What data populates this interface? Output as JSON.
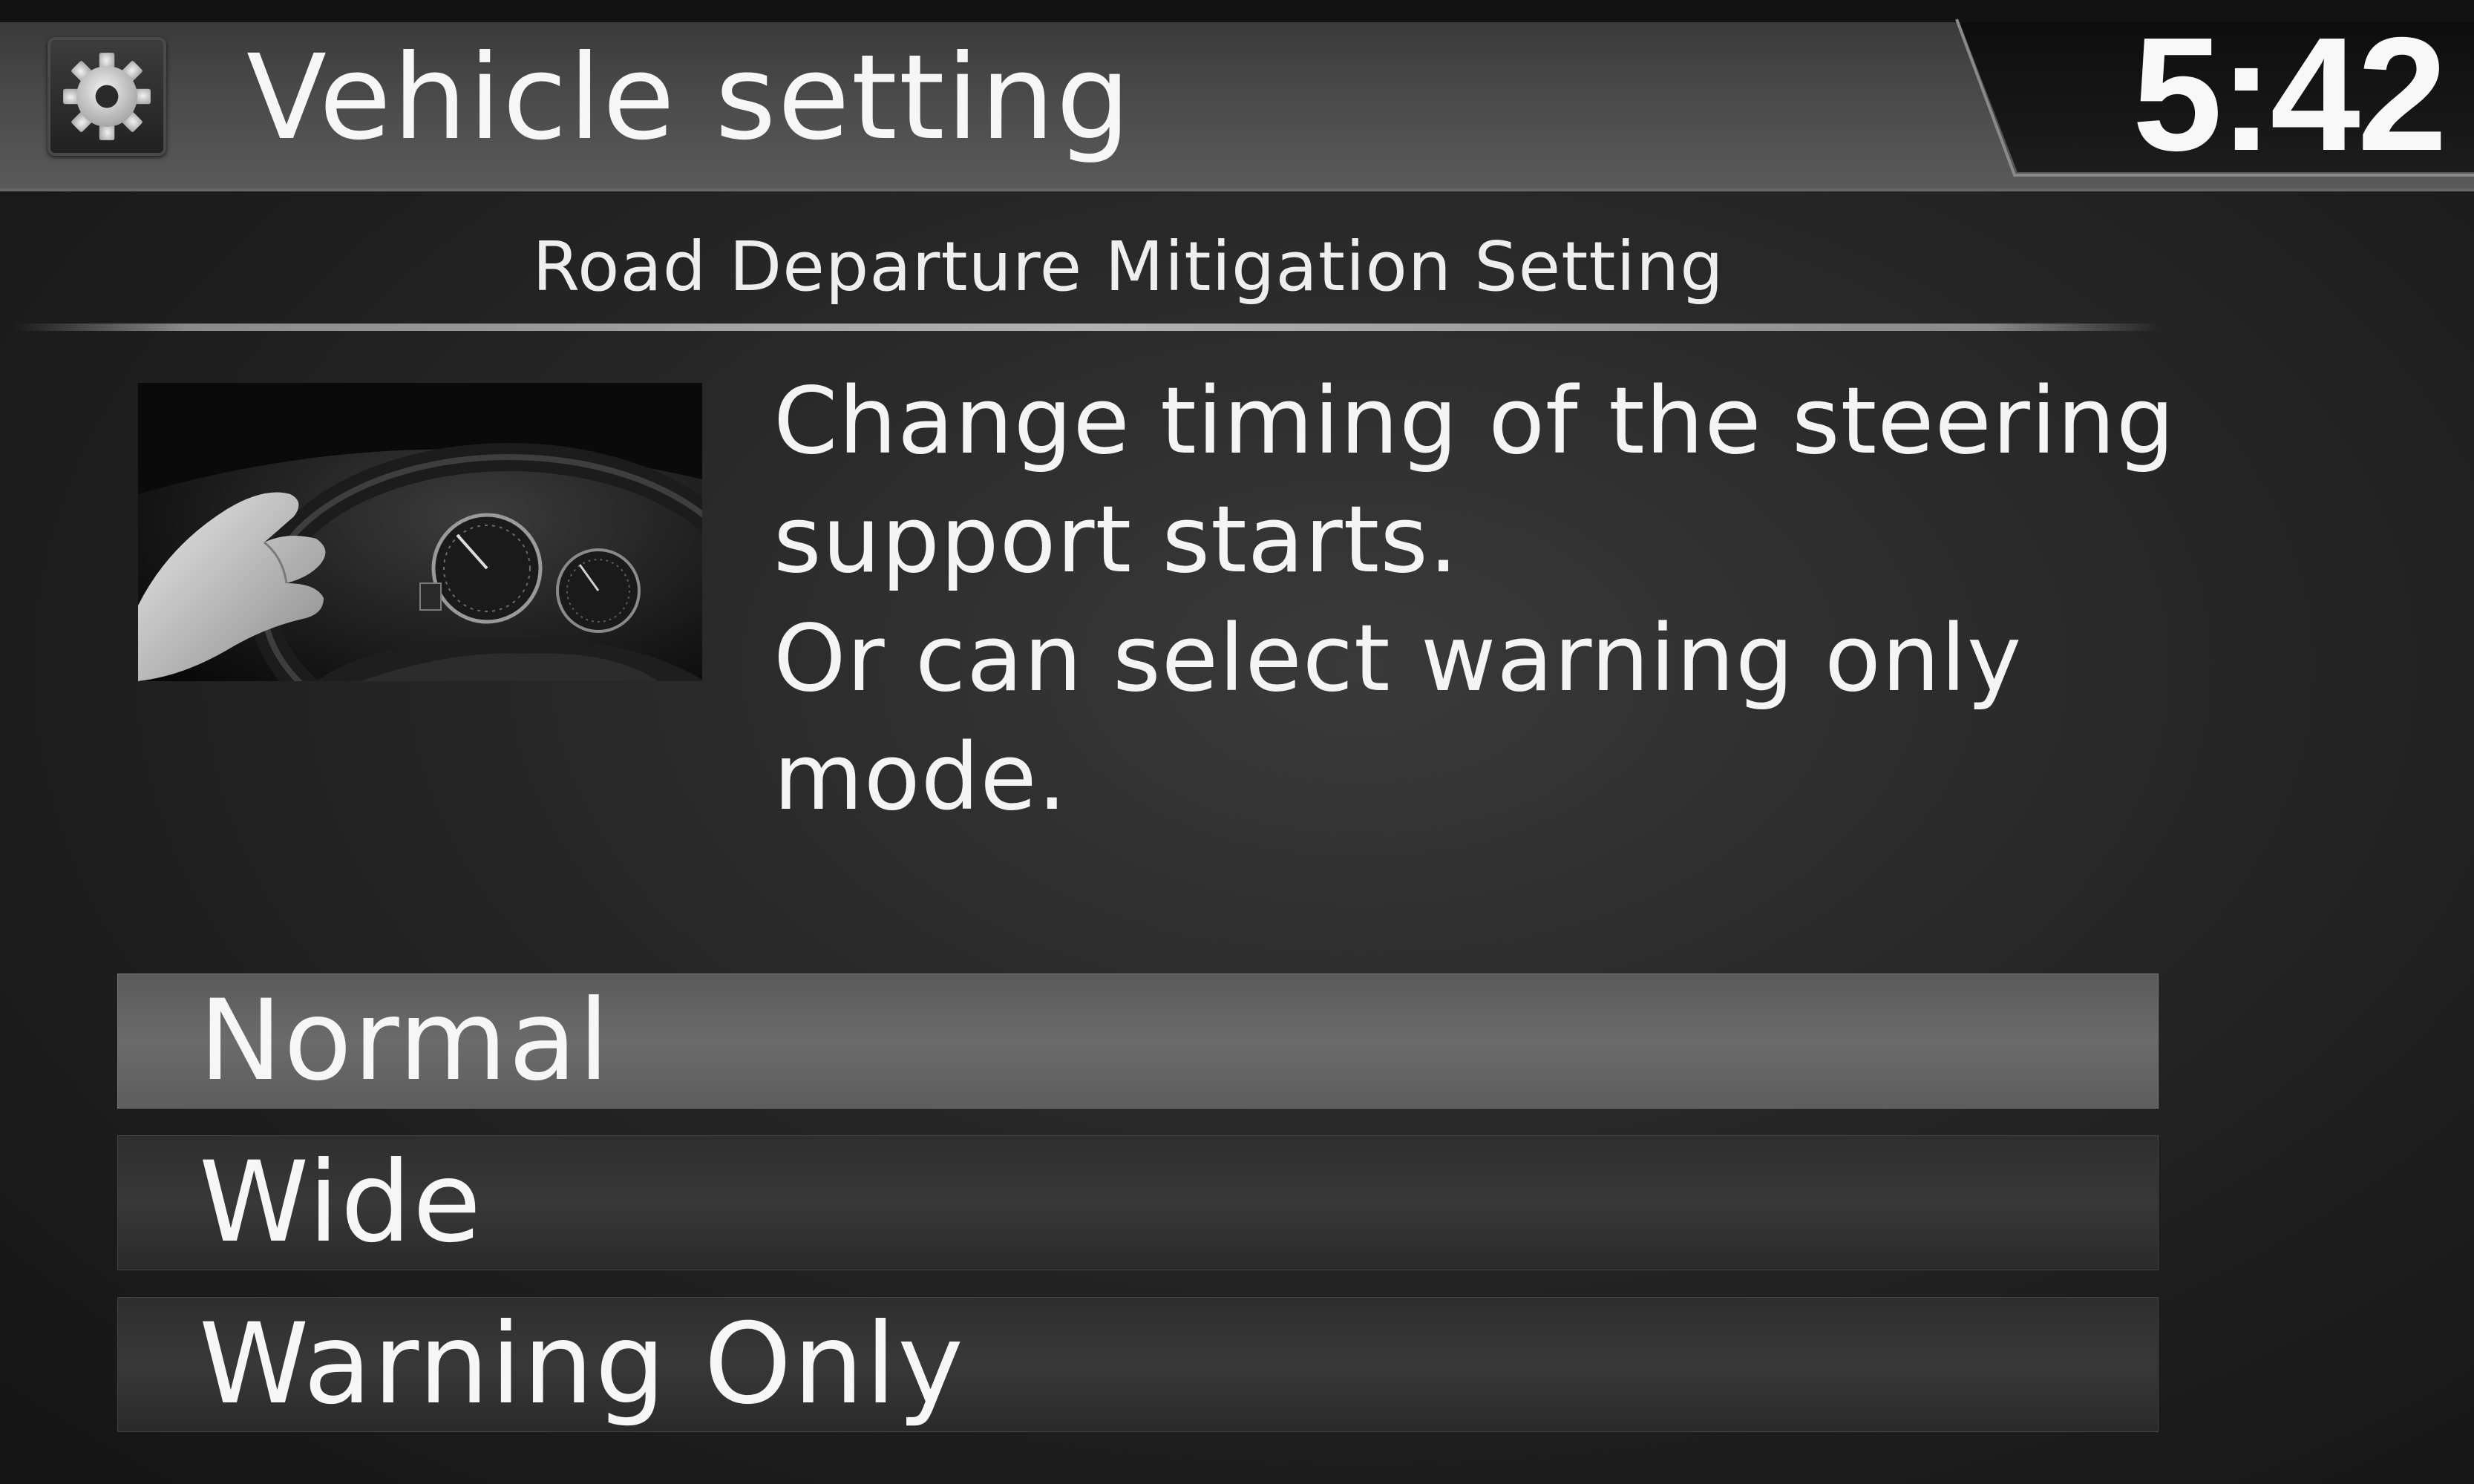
{
  "header": {
    "title": "Vehicle setting",
    "icon": "gear-icon",
    "clock": "5:42"
  },
  "subtitle": "Road Departure Mitigation Setting",
  "thumbnail": {
    "icon": "steering-wheel-illustration"
  },
  "description": {
    "lines": [
      "Change timing of the steering",
      "support starts.",
      "Or can select warning only",
      "mode."
    ]
  },
  "options": [
    {
      "label": "Normal",
      "selected": true
    },
    {
      "label": "Wide",
      "selected": false
    },
    {
      "label": "Warning Only",
      "selected": false
    }
  ],
  "colors": {
    "background": "#1a1a1a",
    "header_bar": "#555555",
    "selected_row": "#666666",
    "row": "#333333",
    "text": "#f4f4f4"
  }
}
